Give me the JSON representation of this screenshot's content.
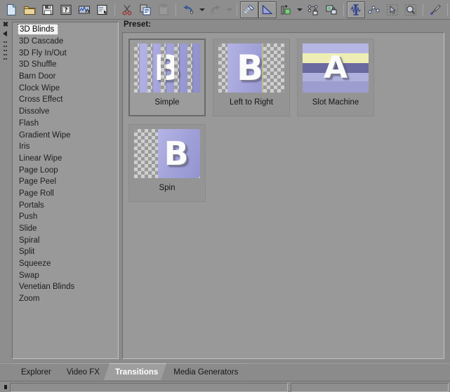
{
  "window": {
    "background": "#8b8b8b",
    "panel_bg": "#999999"
  },
  "toolbar": {
    "buttons": [
      {
        "name": "new-project-icon",
        "label": "New",
        "state": "normal"
      },
      {
        "name": "open-folder-icon",
        "label": "Open",
        "state": "normal"
      },
      {
        "name": "save-icon",
        "label": "Save",
        "state": "normal"
      },
      {
        "name": "save-as-icon",
        "label": "Properties",
        "state": "normal"
      },
      {
        "name": "render-as-icon",
        "label": "Render As",
        "state": "normal"
      },
      {
        "name": "project-props-icon",
        "label": "Project Properties",
        "state": "normal"
      },
      {
        "name": "cut-icon",
        "label": "Cut",
        "state": "normal"
      },
      {
        "name": "copy-icon",
        "label": "Copy",
        "state": "normal"
      },
      {
        "name": "paste-icon",
        "label": "Paste",
        "state": "disabled"
      },
      {
        "name": "undo-icon",
        "label": "Undo",
        "state": "normal"
      },
      {
        "name": "undo-dropdown-icon",
        "label": "Undo History",
        "state": "normal"
      },
      {
        "name": "redo-icon",
        "label": "Redo",
        "state": "disabled"
      },
      {
        "name": "redo-dropdown-icon",
        "label": "Redo History",
        "state": "disabled"
      },
      {
        "name": "enable-snapping-icon",
        "label": "Enable Snapping",
        "state": "pressed"
      },
      {
        "name": "auto-ripple-icon",
        "label": "Auto Ripple",
        "state": "pressed"
      },
      {
        "name": "insert-track-icon",
        "label": "Insert Track",
        "state": "normal"
      },
      {
        "name": "insert-track-dropdown-icon",
        "label": "Insert Track Options",
        "state": "normal"
      },
      {
        "name": "lock-envelope-icon",
        "label": "Lock Envelopes to Events",
        "state": "normal"
      },
      {
        "name": "ignore-grouping-icon",
        "label": "Ignore Event Grouping",
        "state": "normal"
      },
      {
        "name": "edit-tool-icon",
        "label": "Normal Edit Tool",
        "state": "pressed"
      },
      {
        "name": "envelope-tool-icon",
        "label": "Envelope Edit Tool",
        "state": "normal"
      },
      {
        "name": "selection-tool-icon",
        "label": "Selection Edit Tool",
        "state": "normal"
      },
      {
        "name": "zoom-tool-icon",
        "label": "Zoom Edit Tool",
        "state": "normal"
      },
      {
        "name": "paint-tool-icon",
        "label": "Paint Tool",
        "state": "normal"
      },
      {
        "name": "whats-this-icon",
        "label": "What's This Help",
        "state": "normal"
      }
    ]
  },
  "dock": {
    "close_glyph": "✖",
    "collapse_name": "collapse-arrow-icon",
    "grip_name": "drag-grip"
  },
  "transition_list": {
    "selected": "3D Blinds",
    "items": [
      "3D Blinds",
      "3D Cascade",
      "3D Fly In/Out",
      "3D Shuffle",
      "Barn Door",
      "Clock Wipe",
      "Cross Effect",
      "Dissolve",
      "Flash",
      "Gradient Wipe",
      "Iris",
      "Linear Wipe",
      "Page Loop",
      "Page Peel",
      "Page Roll",
      "Portals",
      "Push",
      "Slide",
      "Spiral",
      "Split",
      "Squeeze",
      "Swap",
      "Venetian Blinds",
      "Zoom"
    ]
  },
  "preset_panel": {
    "label": "Preset:",
    "presets": [
      {
        "name": "Simple",
        "letter": "B",
        "selected": true,
        "style": "blinds"
      },
      {
        "name": "Left to Right",
        "letter": "B",
        "selected": false,
        "style": "left-to-right"
      },
      {
        "name": "Slot Machine",
        "letter": "A",
        "selected": false,
        "style": "slot-machine"
      },
      {
        "name": "Spin",
        "letter": "B",
        "selected": false,
        "style": "spin"
      }
    ]
  },
  "tabs": {
    "active": "Transitions",
    "items": [
      "Explorer",
      "Video FX",
      "Transitions",
      "Media Generators"
    ]
  }
}
